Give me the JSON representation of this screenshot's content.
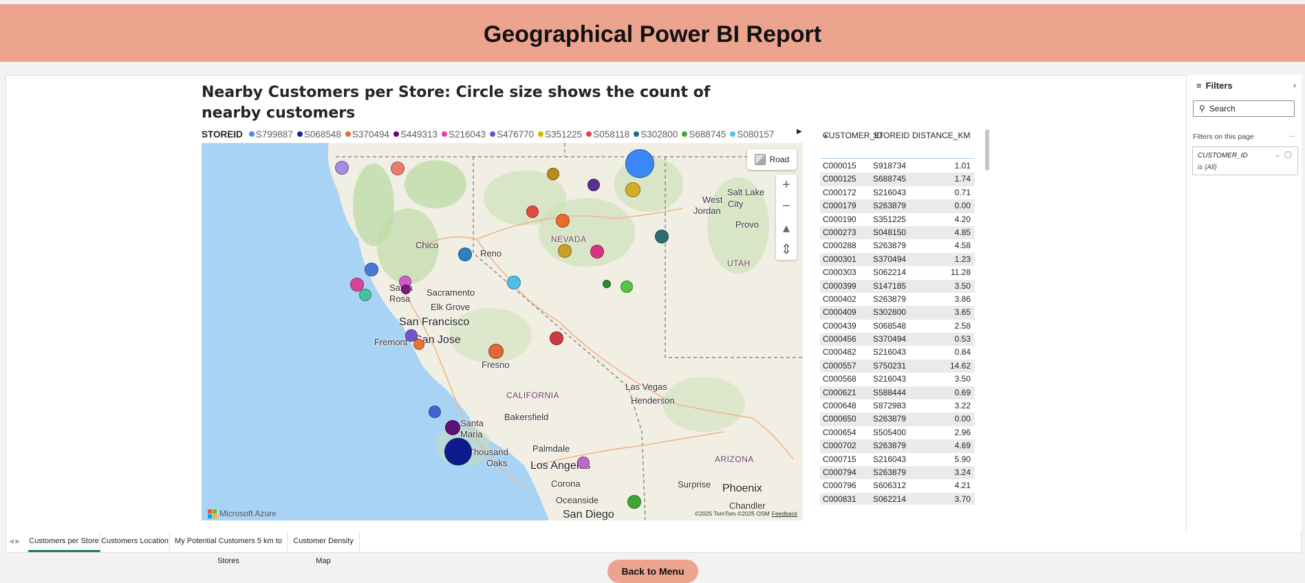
{
  "header": {
    "title": "Geographical Power BI Report"
  },
  "visual": {
    "title": "Nearby Customers per Store: Circle size shows the count of nearby customers",
    "legend_title": "STOREID",
    "legend": [
      {
        "label": "S799887",
        "color": "#4a8cf0"
      },
      {
        "label": "S068548",
        "color": "#12239e"
      },
      {
        "label": "S370494",
        "color": "#e66c37"
      },
      {
        "label": "S449313",
        "color": "#6b007b"
      },
      {
        "label": "S216043",
        "color": "#e044a7"
      },
      {
        "label": "S476770",
        "color": "#744ec2"
      },
      {
        "label": "S351225",
        "color": "#d9b300"
      },
      {
        "label": "S058118",
        "color": "#d64550"
      },
      {
        "label": "S302800",
        "color": "#197278"
      },
      {
        "label": "S688745",
        "color": "#3fa535"
      },
      {
        "label": "S080157",
        "color": "#4fc3e8"
      }
    ],
    "legend_next_icon": "triangle-right-icon"
  },
  "map": {
    "road_label": "Road",
    "zoom_in": "+",
    "zoom_out": "−",
    "provider": "Microsoft Azure",
    "copyright": "©2025 TomTom ©2025 OSM",
    "feedback": "Feedback",
    "cities": [
      {
        "name": "Chico"
      },
      {
        "name": "Reno"
      },
      {
        "name": "Santa"
      },
      {
        "name": "Rosa"
      },
      {
        "name": "Sacramento"
      },
      {
        "name": "Elk Grove"
      },
      {
        "name": "San Francisco"
      },
      {
        "name": "Fremont"
      },
      {
        "name": "San Jose"
      },
      {
        "name": "Fresno"
      },
      {
        "name": "CALIFORNIA"
      },
      {
        "name": "NEVADA"
      },
      {
        "name": "UTAH"
      },
      {
        "name": "ARIZONA"
      },
      {
        "name": "West"
      },
      {
        "name": "Jordan"
      },
      {
        "name": "City"
      },
      {
        "name": "Salt Lake"
      },
      {
        "name": "Provo"
      },
      {
        "name": "Las Vegas"
      },
      {
        "name": "Henderson"
      },
      {
        "name": "Bakersfield"
      },
      {
        "name": "Santa"
      },
      {
        "name": "Maria"
      },
      {
        "name": "Thousand"
      },
      {
        "name": "Oaks"
      },
      {
        "name": "Palmdale"
      },
      {
        "name": "Los Angeles"
      },
      {
        "name": "Corona"
      },
      {
        "name": "Oceanside"
      },
      {
        "name": "San Diego"
      },
      {
        "name": "Surprise"
      },
      {
        "name": "Phoenix"
      },
      {
        "name": "Chandler"
      }
    ]
  },
  "table": {
    "headers": [
      "CUSTOMER_ID",
      "STOREID",
      "DISTANCE_KM"
    ],
    "rows": [
      [
        "C000015",
        "S918734",
        "1.01"
      ],
      [
        "C000125",
        "S688745",
        "1.74"
      ],
      [
        "C000172",
        "S216043",
        "0.71"
      ],
      [
        "C000179",
        "S263879",
        "0.00"
      ],
      [
        "C000190",
        "S351225",
        "4.20"
      ],
      [
        "C000273",
        "S048150",
        "4.85"
      ],
      [
        "C000288",
        "S263879",
        "4.58"
      ],
      [
        "C000301",
        "S370494",
        "1.23"
      ],
      [
        "C000303",
        "S062214",
        "11.28"
      ],
      [
        "C000399",
        "S147185",
        "3.50"
      ],
      [
        "C000402",
        "S263879",
        "3.86"
      ],
      [
        "C000409",
        "S302800",
        "3.65"
      ],
      [
        "C000439",
        "S068548",
        "2.58"
      ],
      [
        "C000456",
        "S370494",
        "0.53"
      ],
      [
        "C000482",
        "S216043",
        "0.84"
      ],
      [
        "C000557",
        "S750231",
        "14.62"
      ],
      [
        "C000568",
        "S216043",
        "3.50"
      ],
      [
        "C000621",
        "S588444",
        "0.69"
      ],
      [
        "C000648",
        "S872983",
        "3.22"
      ],
      [
        "C000650",
        "S263879",
        "0.00"
      ],
      [
        "C000654",
        "S505400",
        "2.96"
      ],
      [
        "C000702",
        "S263879",
        "4.69"
      ],
      [
        "C000715",
        "S216043",
        "5.90"
      ],
      [
        "C000794",
        "S263879",
        "3.24"
      ],
      [
        "C000796",
        "S606312",
        "4.21"
      ],
      [
        "C000831",
        "S062214",
        "3.70"
      ]
    ]
  },
  "filters": {
    "title": "Filters",
    "search_placeholder": "Search",
    "section_label": "Filters on this page",
    "more": "...",
    "card_field": "CUSTOMER_ID",
    "card_value": "is (All)"
  },
  "tabs": [
    {
      "label": "Customers per Store",
      "active": true
    },
    {
      "label": "Customers Location",
      "active": false
    },
    {
      "label": "My Potential Customers 5 km to Stores",
      "active": false
    },
    {
      "label": "Customer Density Map",
      "active": false
    }
  ],
  "back_button": {
    "label": "Back to Menu"
  }
}
